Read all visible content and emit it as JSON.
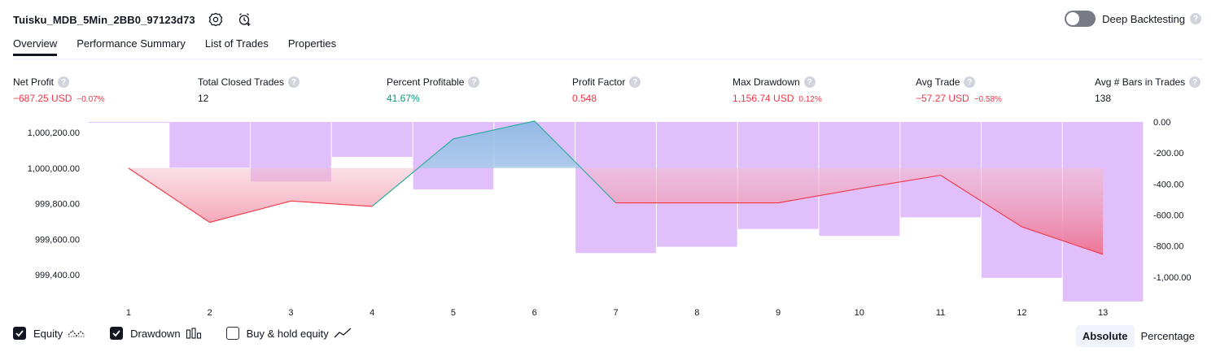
{
  "header": {
    "strategy_name": "Tuisku_MDB_5Min_2BB0_97123d73",
    "deep_backtesting_label": "Deep Backtesting",
    "help_glyph": "?"
  },
  "tabs": [
    "Overview",
    "Performance Summary",
    "List of Trades",
    "Properties"
  ],
  "metrics": [
    {
      "label": "Net Profit",
      "value": "−687.25 USD",
      "sub": "−0.07%",
      "tone": "neg"
    },
    {
      "label": "Total Closed Trades",
      "value": "12",
      "sub": "",
      "tone": "plain"
    },
    {
      "label": "Percent Profitable",
      "value": "41.67%",
      "sub": "",
      "tone": "pos"
    },
    {
      "label": "Profit Factor",
      "value": "0.548",
      "sub": "",
      "tone": "neg"
    },
    {
      "label": "Max Drawdown",
      "value": "1,156.74 USD",
      "sub": "0.12%",
      "tone": "neg"
    },
    {
      "label": "Avg Trade",
      "value": "−57.27 USD",
      "sub": "−0.58%",
      "tone": "neg"
    },
    {
      "label": "Avg # Bars in Trades",
      "value": "138",
      "sub": "",
      "tone": "plain"
    }
  ],
  "legend": {
    "equity": "Equity",
    "drawdown": "Drawdown",
    "buy_hold": "Buy & hold equity"
  },
  "modes": {
    "absolute": "Absolute",
    "percentage": "Percentage"
  },
  "colors": {
    "equity_line_loss": "#f23645",
    "equity_line_gain": "#22ab94",
    "drawdown_bar": "#e1bffb",
    "accent_text": "#131722"
  },
  "chart_data": {
    "type": "bar",
    "x": [
      1,
      2,
      3,
      4,
      5,
      6,
      7,
      8,
      9,
      10,
      11,
      12,
      13
    ],
    "equity_ticks": [
      "1,000,200.00",
      "1,000,000.00",
      "999,800.00",
      "999,600.00",
      "999,400.00"
    ],
    "equity_tick_values": [
      1000200,
      1000000,
      999800,
      999600,
      999400
    ],
    "equity_ylim": [
      999300,
      1000260
    ],
    "drawdown_ticks": [
      "0.00",
      "-200.00",
      "-400.00",
      "-600.00",
      "-800.00",
      "-1,000.00"
    ],
    "drawdown_tick_values": [
      0,
      -200,
      -400,
      -600,
      -800,
      -1000
    ],
    "drawdown_ylim": [
      -1100,
      0
    ],
    "series": [
      {
        "name": "Equity",
        "type": "line",
        "values": [
          1000000,
          999695,
          999815,
          999785,
          1000165,
          1000265,
          999805,
          999805,
          999805,
          999885,
          999960,
          999670,
          999515
        ]
      },
      {
        "name": "Drawdown",
        "type": "bar",
        "values": [
          -2,
          -295,
          -385,
          -225,
          -435,
          -285,
          -845,
          -805,
          -690,
          -735,
          -615,
          -1005,
          -1157
        ]
      }
    ]
  }
}
